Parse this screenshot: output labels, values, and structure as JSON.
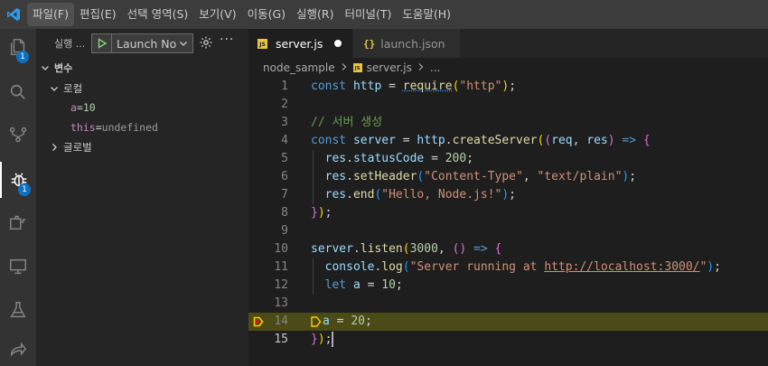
{
  "menu": [
    "파일(F)",
    "편집(E)",
    "선택 영역(S)",
    "보기(V)",
    "이동(G)",
    "실행(R)",
    "터미널(T)",
    "도움말(H)"
  ],
  "activity_bar": {
    "explorer_badge": "1",
    "debug_badge": "1"
  },
  "sidebar": {
    "title": "실행 ...",
    "launch_config": "Launch No",
    "variables_header": "변수",
    "local_header": "로컬",
    "variables": [
      {
        "name": "a",
        "eq": " = ",
        "value": "10"
      },
      {
        "name": "this",
        "eq": " = ",
        "value": "undefined"
      }
    ],
    "global_header": "글로벌"
  },
  "tabs": [
    {
      "label": "server.js",
      "icon": "JS"
    },
    {
      "label": "launch.json",
      "icon": "{}"
    }
  ],
  "breadcrumb": {
    "folder": "node_sample",
    "file": "server.js",
    "tail": "..."
  },
  "editor": {
    "line_numbers": [
      "1",
      "2",
      "3",
      "4",
      "5",
      "6",
      "7",
      "8",
      "9",
      "10",
      "11",
      "12",
      "13",
      "14",
      "15"
    ],
    "current_line": 14,
    "lines": [
      [
        [
          "k",
          "const"
        ],
        [
          "d",
          " "
        ],
        [
          "v",
          "http"
        ],
        [
          "d",
          " = "
        ],
        [
          "fsq",
          "require"
        ],
        [
          "p1",
          "("
        ],
        [
          "s",
          "\"http\""
        ],
        [
          "p1",
          ")"
        ],
        [
          "d",
          ";"
        ]
      ],
      [],
      [
        [
          "c",
          "// 서버 생성"
        ]
      ],
      [
        [
          "k",
          "const"
        ],
        [
          "d",
          " "
        ],
        [
          "v",
          "server"
        ],
        [
          "d",
          " = "
        ],
        [
          "v",
          "http"
        ],
        [
          "d",
          "."
        ],
        [
          "f",
          "createServer"
        ],
        [
          "p1",
          "("
        ],
        [
          "p2",
          "("
        ],
        [
          "v",
          "req"
        ],
        [
          "d",
          ", "
        ],
        [
          "v",
          "res"
        ],
        [
          "p2",
          ")"
        ],
        [
          "d",
          " "
        ],
        [
          "k",
          "=>"
        ],
        [
          "d",
          " "
        ],
        [
          "p2",
          "{"
        ]
      ],
      [
        [
          "d",
          "  "
        ],
        [
          "v",
          "res"
        ],
        [
          "d",
          "."
        ],
        [
          "v",
          "statusCode"
        ],
        [
          "d",
          " = "
        ],
        [
          "n",
          "200"
        ],
        [
          "d",
          ";"
        ]
      ],
      [
        [
          "d",
          "  "
        ],
        [
          "v",
          "res"
        ],
        [
          "d",
          "."
        ],
        [
          "f",
          "setHeader"
        ],
        [
          "p3",
          "("
        ],
        [
          "s",
          "\"Content-Type\""
        ],
        [
          "d",
          ", "
        ],
        [
          "s",
          "\"text/plain\""
        ],
        [
          "p3",
          ")"
        ],
        [
          "d",
          ";"
        ]
      ],
      [
        [
          "d",
          "  "
        ],
        [
          "v",
          "res"
        ],
        [
          "d",
          "."
        ],
        [
          "f",
          "end"
        ],
        [
          "p3",
          "("
        ],
        [
          "s",
          "\"Hello, Node.js!\""
        ],
        [
          "p3",
          ")"
        ],
        [
          "d",
          ";"
        ]
      ],
      [
        [
          "p2",
          "}"
        ],
        [
          "p1",
          ")"
        ],
        [
          "d",
          ";"
        ]
      ],
      [],
      [
        [
          "v",
          "server"
        ],
        [
          "d",
          "."
        ],
        [
          "f",
          "listen"
        ],
        [
          "p1",
          "("
        ],
        [
          "n",
          "3000"
        ],
        [
          "d",
          ", "
        ],
        [
          "p2",
          "()"
        ],
        [
          "d",
          " "
        ],
        [
          "k",
          "=>"
        ],
        [
          "d",
          " "
        ],
        [
          "p2",
          "{"
        ]
      ],
      [
        [
          "d",
          "  "
        ],
        [
          "v",
          "console"
        ],
        [
          "d",
          "."
        ],
        [
          "f",
          "log"
        ],
        [
          "p3",
          "("
        ],
        [
          "s",
          "\"Server running at "
        ],
        [
          "su",
          "http://localhost:3000/"
        ],
        [
          "s",
          "\""
        ],
        [
          "p3",
          ")"
        ],
        [
          "d",
          ";"
        ]
      ],
      [
        [
          "d",
          "  "
        ],
        [
          "k",
          "let"
        ],
        [
          "d",
          " "
        ],
        [
          "v",
          "a"
        ],
        [
          "d",
          " = "
        ],
        [
          "n",
          "10"
        ],
        [
          "d",
          ";"
        ]
      ],
      [],
      [
        [
          "bp",
          ""
        ],
        [
          "v",
          "a"
        ],
        [
          "d",
          " = "
        ],
        [
          "n",
          "20"
        ],
        [
          "d",
          ";"
        ]
      ],
      [
        [
          "p2",
          "}"
        ],
        [
          "p1",
          ")"
        ],
        [
          "d",
          ";"
        ],
        [
          "cur",
          ""
        ]
      ]
    ]
  }
}
